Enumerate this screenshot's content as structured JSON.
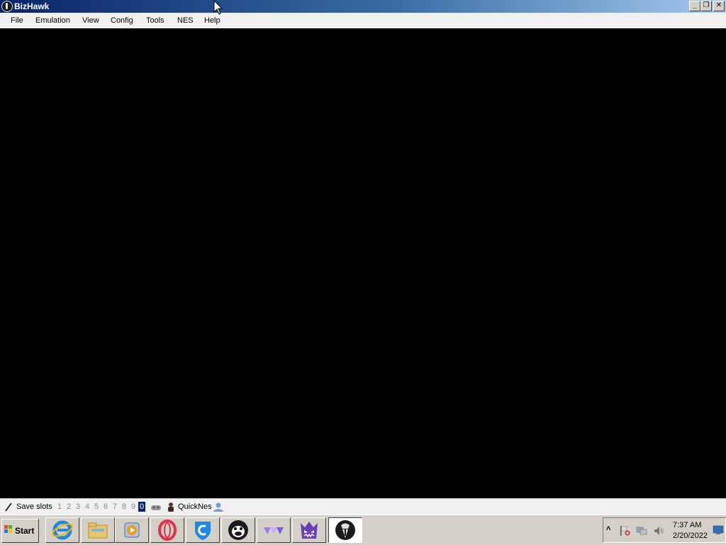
{
  "window": {
    "title": "BizHawk",
    "controls": {
      "minimize": "_",
      "restore": "❐",
      "close": "✕"
    }
  },
  "menu": {
    "items": [
      "File",
      "Emulation",
      "View",
      "Config",
      "Tools",
      "NES",
      "Help"
    ]
  },
  "status": {
    "save_slots_label": "Save slots",
    "slots": [
      "1",
      "2",
      "3",
      "4",
      "5",
      "6",
      "7",
      "8",
      "9",
      "0"
    ],
    "active_slot": "0",
    "core_name": "QuickNes"
  },
  "taskbar": {
    "start_label": "Start",
    "apps": [
      {
        "name": "internet-explorer-icon"
      },
      {
        "name": "file-explorer-icon"
      },
      {
        "name": "media-player-icon"
      },
      {
        "name": "opera-icon"
      },
      {
        "name": "shield-app-icon"
      },
      {
        "name": "penguin-app-icon"
      },
      {
        "name": "triangles-app-icon"
      },
      {
        "name": "cat-monster-app-icon"
      },
      {
        "name": "bizhawk-app-icon",
        "active": true
      }
    ],
    "clock": {
      "time": "7:37 AM",
      "date": "2/20/2022"
    }
  },
  "colors": {
    "titlebar_start": "#0a246a",
    "titlebar_end": "#a6caf0",
    "screen": "#000000",
    "active_slot": "#0a246a"
  }
}
